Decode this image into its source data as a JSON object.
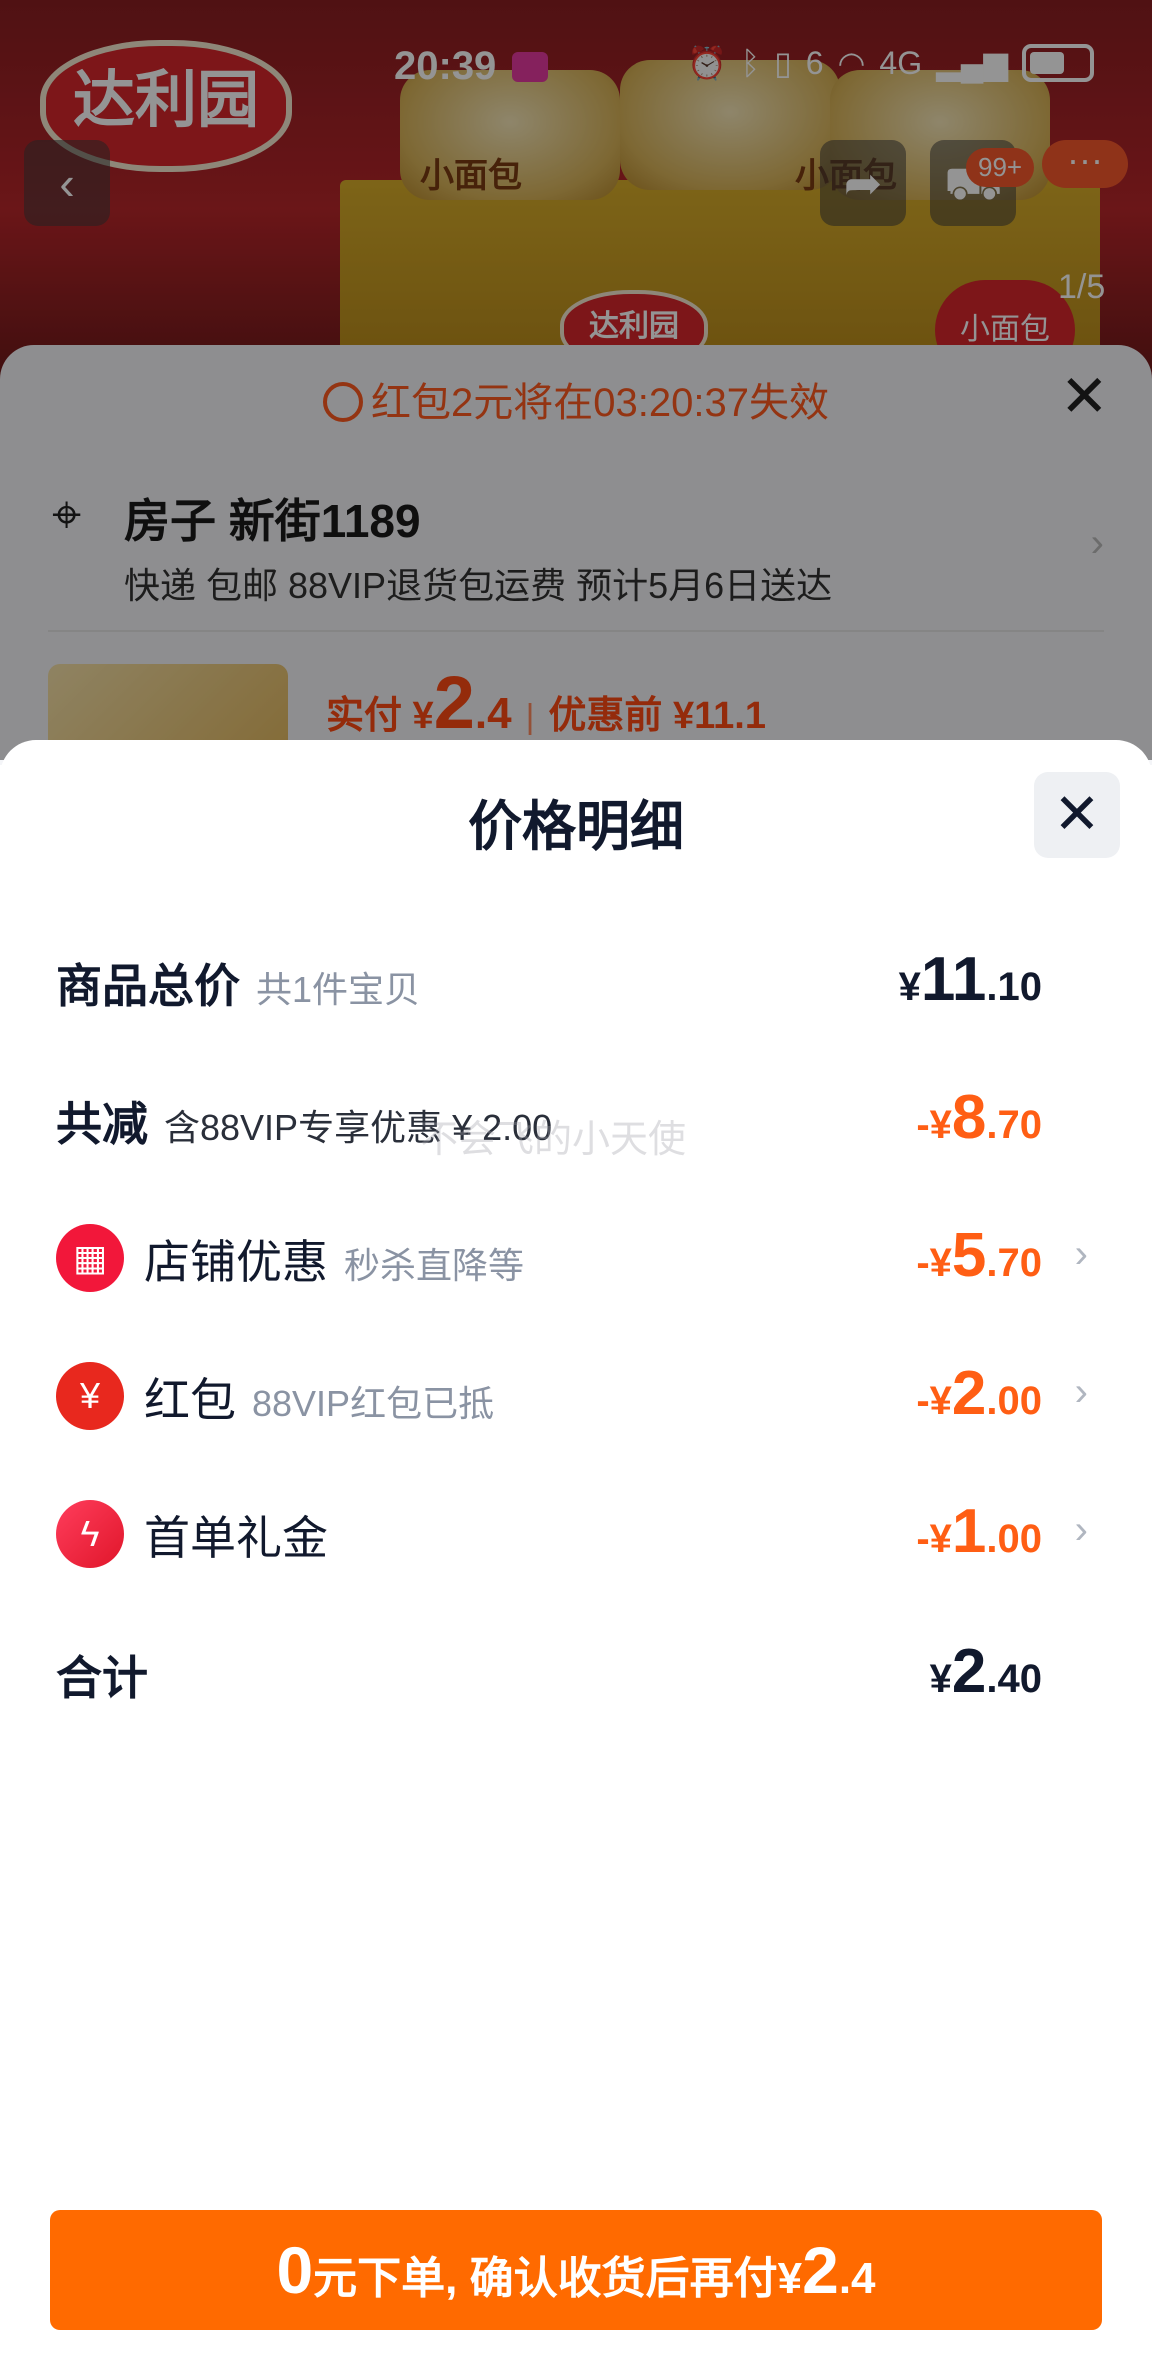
{
  "status_bar": {
    "time": "20:39",
    "network": "4G",
    "sim_label": "6"
  },
  "background_page": {
    "brand_text": "达利园",
    "product_text": "小面包",
    "cart_count": "99+",
    "more_label": "···",
    "page_indicator": "1/5",
    "coupon_timer": "红包2元将在03:20:37失效",
    "address": "房子 新街1189",
    "shipping": "快递 包邮 88VIP退货包运费 预计5月6日送达",
    "paid_label": "实付 ¥",
    "paid_int": "2",
    "paid_dec": ".4",
    "before_discount": "优惠前 ¥11.1"
  },
  "sheet": {
    "title": "价格明细",
    "watermark": "不会飞的小天使",
    "rows": [
      {
        "label": "商品总价",
        "sub": "共1件宝贝",
        "sign": "",
        "sym": "¥",
        "int": "11",
        "dec": ".10"
      },
      {
        "label": "共减",
        "sub": "含88VIP专享优惠 ¥ 2.00",
        "sign": "-",
        "sym": "¥",
        "int": "8",
        "dec": ".70"
      },
      {
        "label": "店铺优惠",
        "sub": "秒杀直降等",
        "sign": "-",
        "sym": "¥",
        "int": "5",
        "dec": ".70",
        "icon": "shop-icon"
      },
      {
        "label": "红包",
        "sub": "88VIP红包已抵",
        "sign": "-",
        "sym": "¥",
        "int": "2",
        "dec": ".00",
        "icon": "red-packet-icon"
      },
      {
        "label": "首单礼金",
        "sub": "",
        "sign": "-",
        "sym": "¥",
        "int": "1",
        "dec": ".00",
        "icon": "lightning-icon"
      },
      {
        "label": "合计",
        "sub": "",
        "sign": "",
        "sym": "¥",
        "int": "2",
        "dec": ".40"
      }
    ],
    "cta": {
      "zero": "0",
      "text": "元下单, 确认收货后再付",
      "sym": "¥",
      "int": "2",
      "dec": ".4"
    }
  },
  "colors": {
    "accent_orange": "#ff6a00",
    "discount_orange": "#ff5e14",
    "text_dark": "#11192d"
  }
}
